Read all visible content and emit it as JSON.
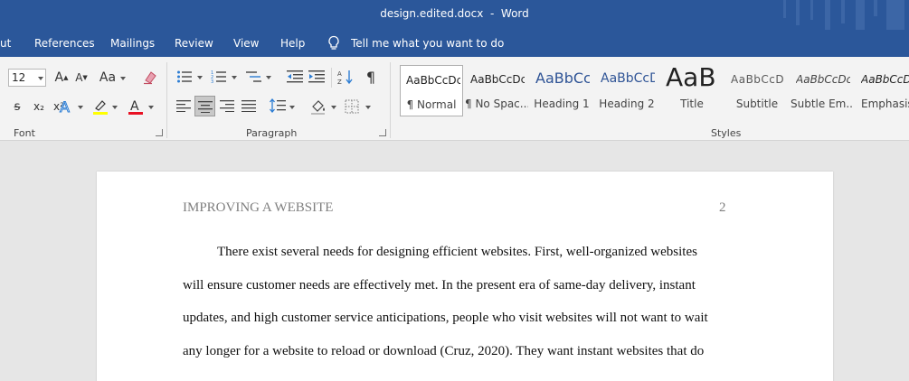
{
  "window": {
    "title": "design.edited.docx  -  Word"
  },
  "menu": {
    "tabs": [
      "ut",
      "References",
      "Mailings",
      "Review",
      "View",
      "Help"
    ],
    "tell_me": "Tell me what you want to do"
  },
  "ribbon": {
    "font": {
      "size": "12",
      "group_label": "Font",
      "aa_label": "Aa",
      "sub_label": "x₂",
      "sup_label": "x²"
    },
    "paragraph": {
      "group_label": "Paragraph"
    },
    "styles": {
      "group_label": "Styles",
      "items": [
        {
          "preview": "AaBbCcDc",
          "label": "¶ Normal"
        },
        {
          "preview": "AaBbCcDc",
          "label": "¶ No Spac..."
        },
        {
          "preview": "AaBbCc",
          "label": "Heading 1"
        },
        {
          "preview": "AaBbCcD",
          "label": "Heading 2"
        },
        {
          "preview": "AaB",
          "label": "Title"
        },
        {
          "preview": "AaBbCcD",
          "label": "Subtitle"
        },
        {
          "preview": "AaBbCcDc",
          "label": "Subtle Em..."
        },
        {
          "preview": "AaBbCcDc",
          "label": "Emphasis"
        }
      ]
    }
  },
  "document": {
    "header": "IMPROVING A WEBSITE",
    "page_number": "2",
    "lines": [
      "There exist several needs for designing efficient websites. First, well-organized websites",
      "will ensure customer needs are effectively met. In the present era of same-day delivery, instant",
      "updates, and high customer service anticipations, people who visit websites will not want to wait",
      "any longer for a website to reload or download (Cruz, 2020). They want instant websites that do"
    ]
  },
  "colors": {
    "word_blue": "#2b579a",
    "selected_style": "#ffffff"
  }
}
